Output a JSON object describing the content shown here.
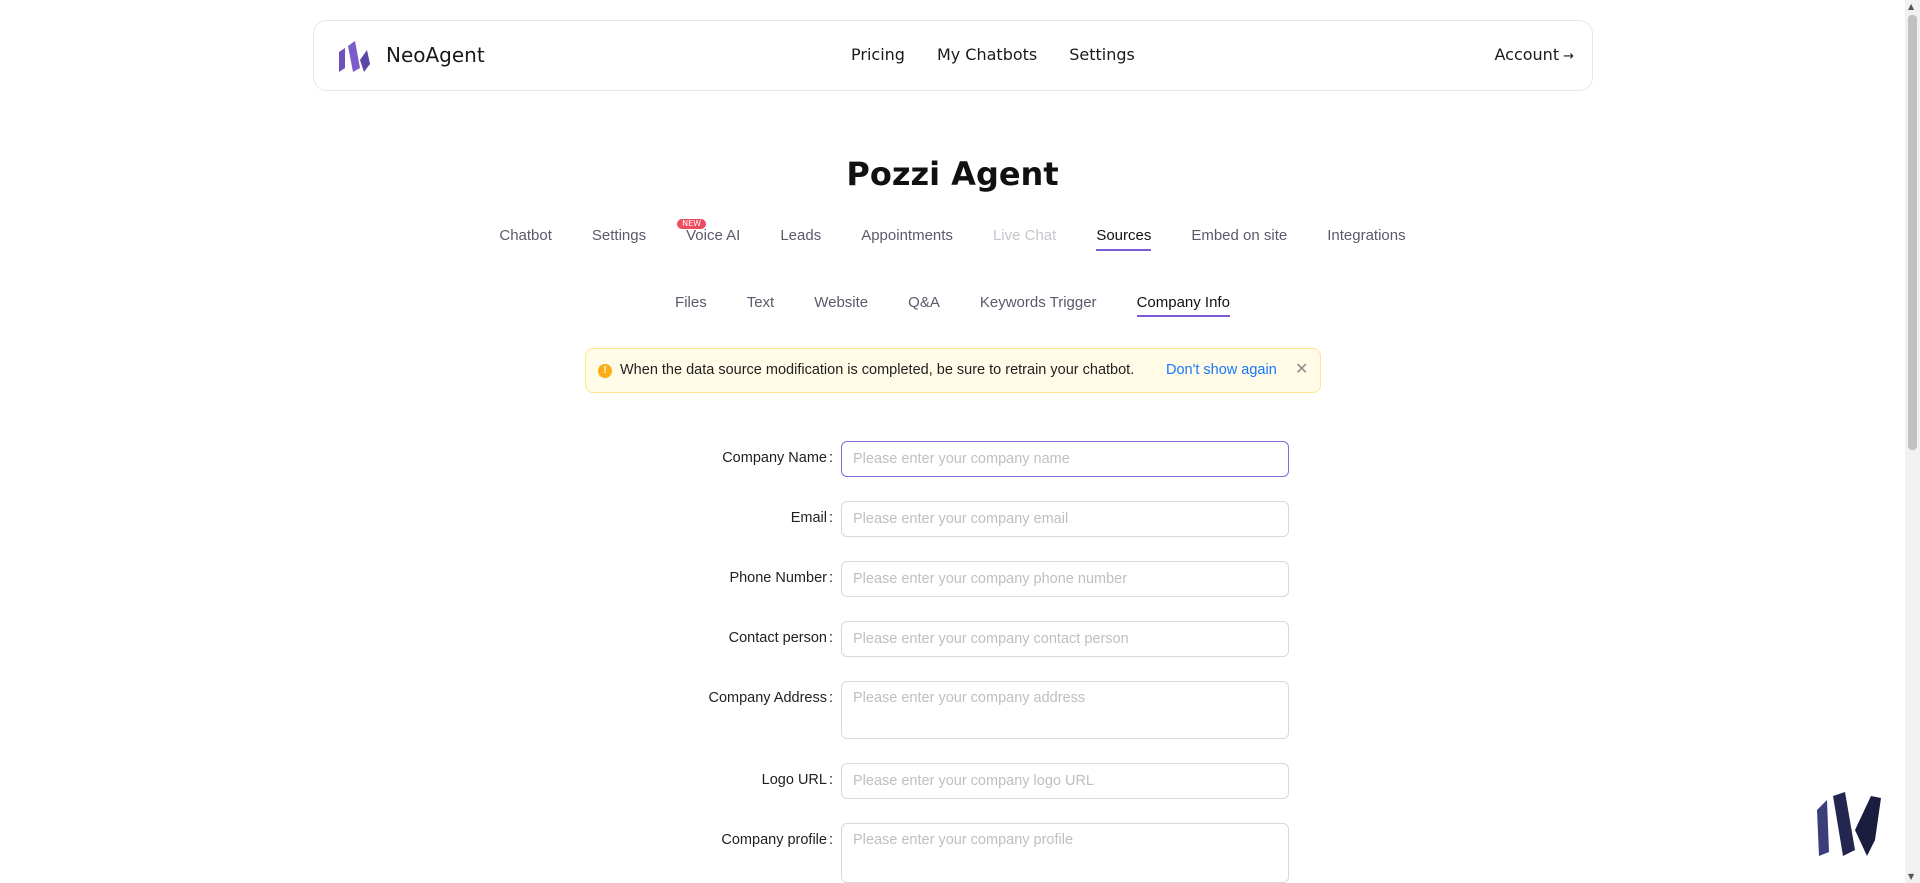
{
  "header": {
    "brand": "NeoAgent",
    "nav": [
      "Pricing",
      "My Chatbots",
      "Settings"
    ],
    "account": "Account",
    "account_arrow": "→"
  },
  "page_title": "Pozzi Agent",
  "tabs": [
    {
      "label": "Chatbot",
      "state": "normal"
    },
    {
      "label": "Settings",
      "state": "normal"
    },
    {
      "label": "Voice AI",
      "state": "normal",
      "badge": "NEW"
    },
    {
      "label": "Leads",
      "state": "normal"
    },
    {
      "label": "Appointments",
      "state": "normal"
    },
    {
      "label": "Live Chat",
      "state": "disabled"
    },
    {
      "label": "Sources",
      "state": "active"
    },
    {
      "label": "Embed on site",
      "state": "normal"
    },
    {
      "label": "Integrations",
      "state": "normal"
    }
  ],
  "subtabs": [
    {
      "label": "Files",
      "state": "normal"
    },
    {
      "label": "Text",
      "state": "normal"
    },
    {
      "label": "Website",
      "state": "normal"
    },
    {
      "label": "Q&A",
      "state": "normal"
    },
    {
      "label": "Keywords Trigger",
      "state": "normal"
    },
    {
      "label": "Company Info",
      "state": "active"
    }
  ],
  "alert": {
    "icon": "exclamation-circle-icon",
    "message": "When the data source modification is completed, be sure to retrain your chatbot.",
    "link": "Don't show again",
    "close": "close-icon"
  },
  "form": {
    "fields": [
      {
        "label": "Company Name",
        "placeholder": "Please enter your company name",
        "value": ""
      },
      {
        "label": "Email",
        "placeholder": "Please enter your company email",
        "value": ""
      },
      {
        "label": "Phone Number",
        "placeholder": "Please enter your company phone number",
        "value": ""
      },
      {
        "label": "Contact person",
        "placeholder": "Please enter your company contact person",
        "value": ""
      },
      {
        "label": "Company Address",
        "placeholder": "Please enter your company address",
        "value": ""
      },
      {
        "label": "Logo URL",
        "placeholder": "Please enter your company logo URL",
        "value": ""
      },
      {
        "label": "Company profile",
        "placeholder": "Please enter your company profile",
        "value": ""
      }
    ]
  },
  "colors": {
    "accent": "#7c5cd6",
    "badge": "#ef4b5f",
    "alert_bg": "#fffbe6",
    "alert_border": "#ffe58f",
    "link": "#1677ff",
    "warning_icon": "#faad14"
  }
}
